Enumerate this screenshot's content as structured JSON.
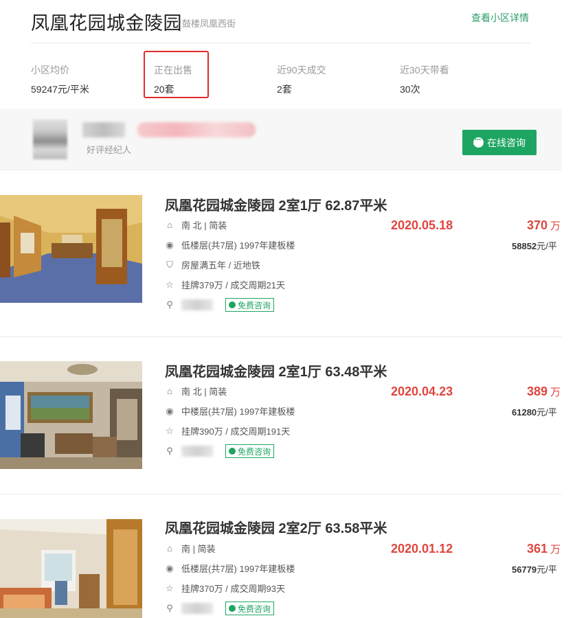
{
  "community": {
    "name": "凤凰花园城金陵园",
    "street": "鼓楼凤凰西街",
    "detail_link": "查看小区详情"
  },
  "stats": [
    {
      "label": "小区均价",
      "value": "59247元/平米"
    },
    {
      "label": "正在出售",
      "value": "20套"
    },
    {
      "label": "近90天成交",
      "value": "2套"
    },
    {
      "label": "近30天带看",
      "value": "30次"
    }
  ],
  "agent": {
    "tag": "好评经纪人",
    "consult_label": "在线咨询"
  },
  "listings": [
    {
      "title": "凤凰花园城金陵园 2室1厅 62.87平米",
      "orientation": "南 北 | 简装",
      "floor": "低楼层(共7层) 1997年建板楼",
      "tags": "房屋满五年 / 近地铁",
      "listing_info": "挂牌379万 / 成交周期21天",
      "consult": "免费咨询",
      "date": "2020.05.18",
      "price": "370",
      "price_unit": "万",
      "unit_price": "58852",
      "unit_price_suffix": "元/平"
    },
    {
      "title": "凤凰花园城金陵园 2室1厅 63.48平米",
      "orientation": "南 北 | 简装",
      "floor": "中楼层(共7层) 1997年建板楼",
      "listing_info": "挂牌390万 / 成交周期191天",
      "consult": "免费咨询",
      "date": "2020.04.23",
      "price": "389",
      "price_unit": "万",
      "unit_price": "61280",
      "unit_price_suffix": "元/平"
    },
    {
      "title": "凤凰花园城金陵园 2室2厅 63.58平米",
      "orientation": "南 | 简装",
      "floor": "低楼层(共7层) 1997年建板楼",
      "listing_info": "挂牌370万 / 成交周期93天",
      "consult": "免费咨询",
      "date": "2020.01.12",
      "price": "361",
      "price_unit": "万",
      "unit_price": "56779",
      "unit_price_suffix": "元/平"
    }
  ],
  "colors": {
    "accent_green": "#1ea561",
    "price_red": "#e0453e",
    "highlight_red": "#e12a2a"
  }
}
